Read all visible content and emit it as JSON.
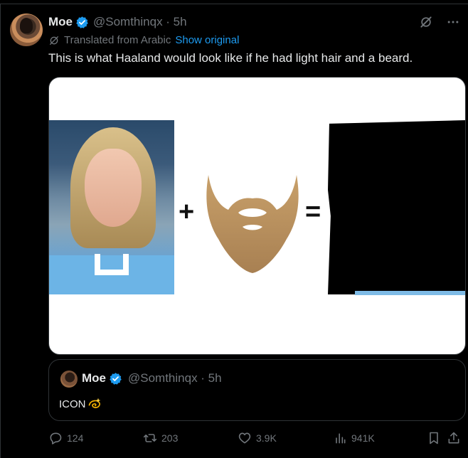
{
  "tweet": {
    "author_name": "Moe",
    "handle_time": "@Somthinqx · 5h",
    "translated_text": "Translated from Arabic",
    "show_original": "Show original",
    "text": "This is what Haaland would look like if he had light hair and a beard.",
    "media": {
      "plus_sign": "+",
      "equals_sign": "="
    }
  },
  "quote": {
    "author_name": "Moe",
    "handle_time": "@Somthinqx · 5h",
    "text": "ICON"
  },
  "actions": {
    "replies": "124",
    "reposts": "203",
    "likes": "3.9K",
    "views": "941K"
  },
  "icons": {
    "verified": "verified-badge-icon",
    "grok": "grok-icon",
    "more": "more-icon",
    "translate": "translate-icon",
    "reply": "reply-icon",
    "repost": "repost-icon",
    "like": "heart-icon",
    "views": "analytics-icon",
    "bookmark": "bookmark-icon",
    "share": "share-icon",
    "dizzy": "dizzy-emoji-icon"
  },
  "colors": {
    "accent": "#1d9bf0",
    "muted": "#71767b",
    "text": "#e7e9ea",
    "background": "#000000"
  }
}
